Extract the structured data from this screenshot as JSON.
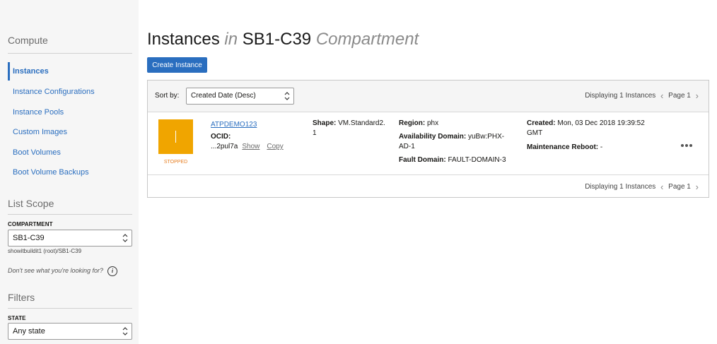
{
  "sidebar": {
    "compute_heading": "Compute",
    "nav": [
      {
        "label": "Instances",
        "active": true
      },
      {
        "label": "Instance Configurations",
        "active": false
      },
      {
        "label": "Instance Pools",
        "active": false
      },
      {
        "label": "Custom Images",
        "active": false
      },
      {
        "label": "Boot Volumes",
        "active": false
      },
      {
        "label": "Boot Volume Backups",
        "active": false
      }
    ],
    "list_scope_heading": "List Scope",
    "compartment_label": "COMPARTMENT",
    "compartment_value": "SB1-C39",
    "compartment_path": "showitbuildit1 (root)/SB1-C39",
    "help_text": "Don't see what you're looking for?",
    "filters_heading": "Filters",
    "state_label": "STATE",
    "state_value": "Any state"
  },
  "page": {
    "title_main": "Instances",
    "title_in": "in",
    "title_compartment": "SB1-C39",
    "title_suffix": "Compartment",
    "create_button": "Create Instance"
  },
  "list": {
    "sort_label": "Sort by:",
    "sort_value": "Created Date (Desc)",
    "pager_text": "Displaying 1 Instances",
    "page_text": "Page 1"
  },
  "instance": {
    "name": "ATPDEMO123",
    "status": "STOPPED",
    "ocid_label": "OCID:",
    "ocid_value": "...2pul7a",
    "show_link": "Show",
    "copy_link": "Copy",
    "shape_label": "Shape:",
    "shape_value_line1": "VM.Standard2.",
    "shape_value_line2": "1",
    "region_label": "Region:",
    "region_value": "phx",
    "ad_label": "Availability Domain:",
    "ad_value_line1": "yuBw:PHX-",
    "ad_value_line2": "AD-1",
    "fd_label": "Fault Domain:",
    "fd_value": "FAULT-DOMAIN-3",
    "created_label": "Created:",
    "created_value_line1": "Mon, 03 Dec 2018 19:39:52",
    "created_value_line2": "GMT",
    "maint_label": "Maintenance Reboot:",
    "maint_value": "-"
  },
  "colors": {
    "accent": "#2a6ebf",
    "stopped_tile": "#f0a500",
    "stopped_text": "#e67e22"
  },
  "icons": [
    "chevron-up-down-icon",
    "info-icon",
    "chevron-left-icon",
    "chevron-right-icon",
    "more-actions-icon"
  ]
}
